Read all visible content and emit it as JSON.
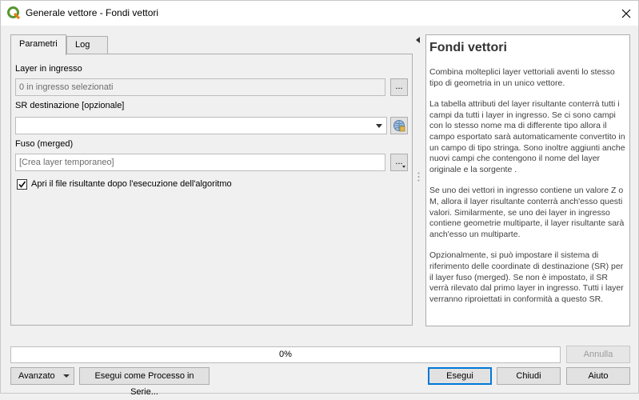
{
  "window": {
    "title": "Generale vettore - Fondi vettori",
    "icons": {
      "app": "qgis-logo-icon",
      "close": "close-icon"
    }
  },
  "tabs": [
    {
      "label": "Parametri",
      "active": true
    },
    {
      "label": "Log",
      "active": false
    }
  ],
  "params": {
    "input_layer": {
      "label": "Layer in ingresso",
      "value": "0 in ingresso selezionati",
      "button": "..."
    },
    "crs": {
      "label": "SR destinazione [opzionale]",
      "value": ""
    },
    "output": {
      "label": "Fuso (merged)",
      "placeholder": "[Crea layer temporaneo]",
      "button": "..."
    },
    "open_output": {
      "label": "Apri il file risultante dopo l'esecuzione dell'algoritmo",
      "checked": true
    }
  },
  "help": {
    "title": "Fondi vettori",
    "paragraphs": [
      "Combina molteplici layer vettoriali aventi lo stesso tipo di geometria in un unico vettore.",
      "La tabella attributi del layer risultante conterrà tutti i campi da tutti i layer in ingresso. Se ci sono campi con lo stesso nome ma di differente tipo allora il campo esportato sarà automaticamente convertito in un campo di tipo stringa. Sono inoltre aggiunti anche nuovi campi che contengono il nome del layer originale e la sorgente .",
      "Se uno dei vettori in ingresso contiene un valore Z o M, allora il layer risultante conterrà anch'esso questi valori. Similarmente, se uno dei layer in ingresso contiene geometrie multiparte, il layer risultante sarà anch'esso un multiparte.",
      "Opzionalmente, si può impostare il sistema di riferimento delle coordinate di destinazione (SR) per il layer fuso (merged). Se non è impostato, il SR verrà rilevato dal primo layer in ingresso. Tutti i layer verranno riproiettati in conformità a questo SR."
    ]
  },
  "progress": {
    "text": "0%",
    "value": 0
  },
  "buttons": {
    "cancel": "Annulla",
    "advanced": "Avanzato",
    "batch": "Esegui come Processo in Serie...",
    "run": "Esegui",
    "close": "Chiudi",
    "help": "Aiuto"
  },
  "colors": {
    "accent": "#0078d7",
    "qgis_green": "#589632",
    "qgis_yellow": "#ee7913"
  }
}
